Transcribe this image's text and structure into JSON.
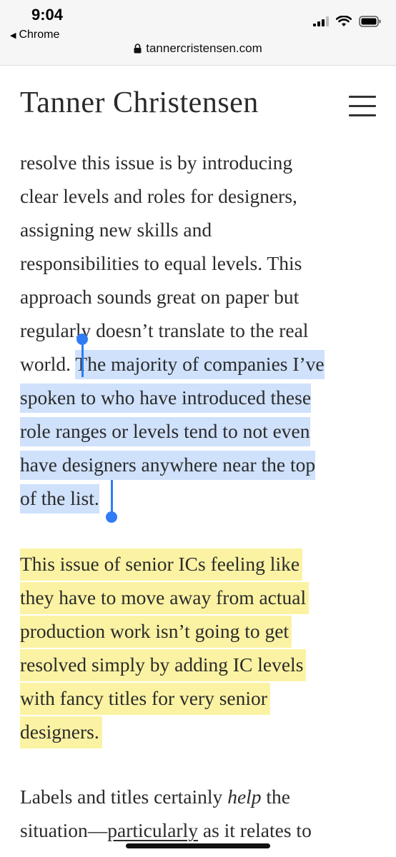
{
  "status_bar": {
    "time": "9:04",
    "back_label": "Chrome",
    "url": "tannercristensen.com",
    "icons": [
      "signal-icon",
      "wifi-icon",
      "battery-icon"
    ]
  },
  "site": {
    "title": "Tanner Christensen"
  },
  "article": {
    "p1": {
      "l1": "resolve this issue is by introducing",
      "l2": "clear levels and roles for designers,",
      "l3": "assigning new skills and",
      "l4": "responsibilities to equal levels. This",
      "l5": "approach sounds great on paper but",
      "l6": "regularly doesn’t translate to the real",
      "l7a": "world. ",
      "l7b": "The majority of companies I’ve",
      "l8": "spoken to who have introduced these",
      "l9": "role ranges or levels tend to not even",
      "l10": "have designers anywhere near the top",
      "l11": "of the list."
    },
    "p2": {
      "l1": "This issue of senior ICs feeling like",
      "l2": "they have to move away from actual",
      "l3": "production work isn’t going to get",
      "l4": "resolved simply by adding IC levels",
      "l5": "with fancy titles for very senior",
      "l6": "designers."
    },
    "p3": {
      "l1a": "Labels and titles certainly ",
      "l1b": "help",
      "l1c": " the",
      "l2a": "situation—",
      "l2b": "particularly",
      "l2c": " as it relates to"
    }
  },
  "colors": {
    "selection": "#cfe1fb",
    "handle": "#2f7cf6",
    "highlight": "#fbf3a3"
  }
}
